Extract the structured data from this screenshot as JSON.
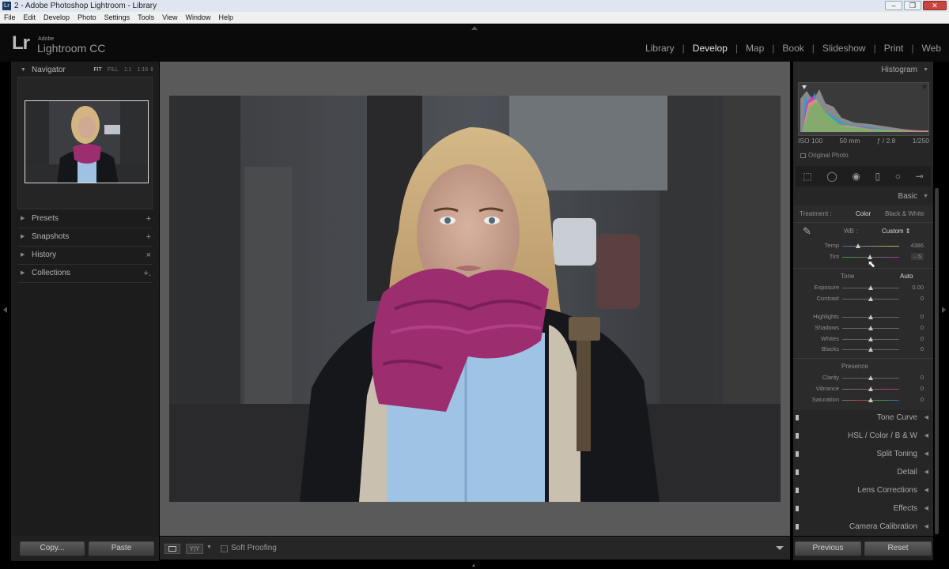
{
  "window": {
    "app_icon": "Lr",
    "title": "2 - Adobe Photoshop Lightroom - Library",
    "minimize": "–",
    "maximize": "❐",
    "close": "✕"
  },
  "menu": [
    "File",
    "Edit",
    "Develop",
    "Photo",
    "Settings",
    "Tools",
    "View",
    "Window",
    "Help"
  ],
  "identity": {
    "mark": "Lr",
    "adobe": "Adobe",
    "product": "Lightroom CC"
  },
  "modules": [
    {
      "label": "Library"
    },
    {
      "label": "Develop"
    },
    {
      "label": "Map"
    },
    {
      "label": "Book"
    },
    {
      "label": "Slideshow"
    },
    {
      "label": "Print"
    },
    {
      "label": "Web"
    }
  ],
  "active_module": "Develop",
  "left_panel": {
    "navigator": {
      "label": "Navigator",
      "options": [
        "FIT",
        "FILL",
        "1:1",
        "1:16 ⇕"
      ],
      "selected_option": "FIT"
    },
    "panels": [
      {
        "label": "Presets",
        "action": "+"
      },
      {
        "label": "Snapshots",
        "action": "+"
      },
      {
        "label": "History",
        "action": "×"
      },
      {
        "label": "Collections",
        "action": "+."
      }
    ],
    "copy": "Copy...",
    "paste": "Paste"
  },
  "toolbar": {
    "view_icon": "loupe-view-icon",
    "compare_icon": "before-after-icon",
    "compare_label": "Y|Y",
    "soft_proofing": "Soft Proofing",
    "soft_proofing_checked": false
  },
  "right_panel": {
    "histogram": {
      "label": "Histogram",
      "iso": "ISO 100",
      "focal": "50 mm",
      "aperture": "ƒ / 2.8",
      "shutter": "1/250",
      "original_photo": "Original Photo"
    },
    "tools": [
      "crop-overlay-icon",
      "spot-removal-icon",
      "red-eye-icon",
      "graduated-filter-icon",
      "radial-filter-icon",
      "adjustment-brush-icon"
    ],
    "basic": {
      "label": "Basic",
      "treatment_label": "Treatment :",
      "treatment_color": "Color",
      "treatment_bw": "Black & White",
      "wb_label": "WB :",
      "wb_value": "Custom ⇕",
      "temp": {
        "label": "Temp",
        "value": "4386",
        "level": 0.28
      },
      "tint": {
        "label": "Tint",
        "value": "– 5",
        "level": 0.48
      },
      "tone_label": "Tone",
      "auto": "Auto",
      "tone": [
        {
          "label": "Exposure",
          "value": "0.00",
          "level": 0.5
        },
        {
          "label": "Contrast",
          "value": "0",
          "level": 0.5
        },
        {
          "label": "Highlights",
          "value": "0",
          "level": 0.5
        },
        {
          "label": "Shadows",
          "value": "0",
          "level": 0.5
        },
        {
          "label": "Whites",
          "value": "0",
          "level": 0.5
        },
        {
          "label": "Blacks",
          "value": "0",
          "level": 0.5
        }
      ],
      "presence_label": "Presence",
      "presence": [
        {
          "label": "Clarity",
          "value": "0",
          "level": 0.5
        },
        {
          "label": "Vibrance",
          "value": "0",
          "level": 0.5
        },
        {
          "label": "Saturation",
          "value": "0",
          "level": 0.5
        }
      ]
    },
    "panels": [
      {
        "label": "Tone Curve"
      },
      {
        "label": "HSL  /  Color  /  B & W"
      },
      {
        "label": "Split Toning"
      },
      {
        "label": "Detail"
      },
      {
        "label": "Lens Corrections"
      },
      {
        "label": "Effects"
      },
      {
        "label": "Camera Calibration"
      }
    ],
    "previous": "Previous",
    "reset": "Reset"
  },
  "colors": {
    "accent_text": "#e6e6e6",
    "panel_bg": "#262626",
    "canvas_bg": "#5a5a5a",
    "scarf": "#9c2d6f"
  }
}
